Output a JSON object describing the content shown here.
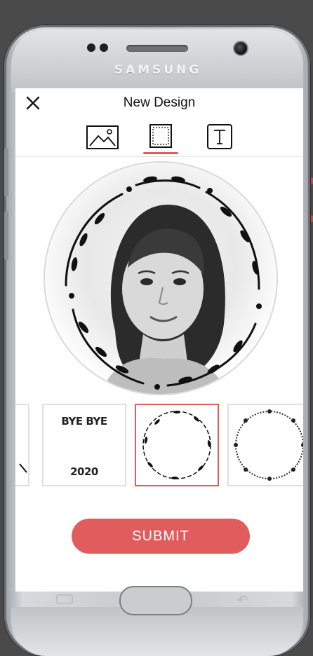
{
  "device": {
    "brand": "SAMSUNG"
  },
  "header": {
    "close_icon": "close-icon",
    "title": "New Design"
  },
  "tabs": [
    {
      "icon": "image-icon",
      "active": false
    },
    {
      "icon": "frame-icon",
      "active": true
    },
    {
      "icon": "text-icon",
      "active": false
    }
  ],
  "thumbnails": [
    {
      "top_text": "",
      "bottom_text": ""
    },
    {
      "top_text": "BYE BYE",
      "bottom_text": "2020"
    },
    {
      "top_text": "",
      "bottom_text": "",
      "selected": true
    },
    {
      "top_text": "",
      "bottom_text": ""
    }
  ],
  "submit": {
    "label": "SUBMIT"
  },
  "colors": {
    "accent": "#e15c5c",
    "text": "#111111",
    "screen_bg": "#ffffff"
  }
}
